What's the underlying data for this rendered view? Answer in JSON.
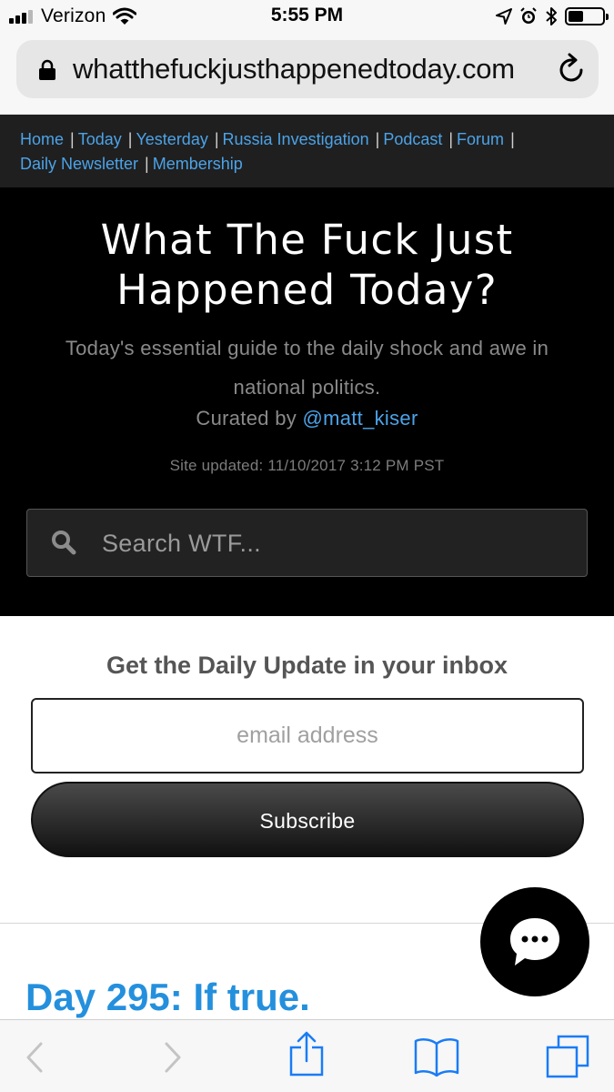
{
  "status_bar": {
    "carrier": "Verizon",
    "time": "5:55 PM",
    "battery_level": 0.45,
    "icons": [
      "signal-bars-icon",
      "wifi-icon",
      "location-arrow-icon",
      "alarm-icon",
      "bluetooth-icon",
      "battery-icon"
    ]
  },
  "browser": {
    "url": "whatthefuckjusthappenedtoday.com",
    "icons": [
      "lock-icon",
      "reload-icon"
    ]
  },
  "nav": {
    "separator": "|",
    "links": [
      "Home",
      "Today",
      "Yesterday",
      "Russia Investigation",
      "Podcast",
      "Forum",
      "Daily Newsletter",
      "Membership"
    ]
  },
  "hero": {
    "title_line1": "What The Fuck Just",
    "title_line2": "Happened Today?",
    "tagline_line1": "Today's essential guide to the daily shock and awe in",
    "tagline_line2": "national politics.",
    "curated_prefix": "Curated by",
    "curator_handle": "@matt_kiser",
    "updated": "Site updated: 11/10/2017 3:12 PM PST",
    "search_placeholder": "Search WTF..."
  },
  "newsletter": {
    "heading": "Get the Daily Update in your inbox",
    "email_placeholder": "email address",
    "subscribe_label": "Subscribe"
  },
  "post": {
    "title": "Day 295: If true."
  },
  "toolbar": {
    "icons": [
      "back-icon",
      "forward-icon",
      "share-icon",
      "bookmarks-icon",
      "tabs-icon"
    ]
  },
  "colors": {
    "link": "#4ca3e8",
    "post_title": "#2490dd",
    "nav_bg": "#1f1f1f",
    "hero_bg": "#000000",
    "ios_blue": "#1a7cf5"
  }
}
